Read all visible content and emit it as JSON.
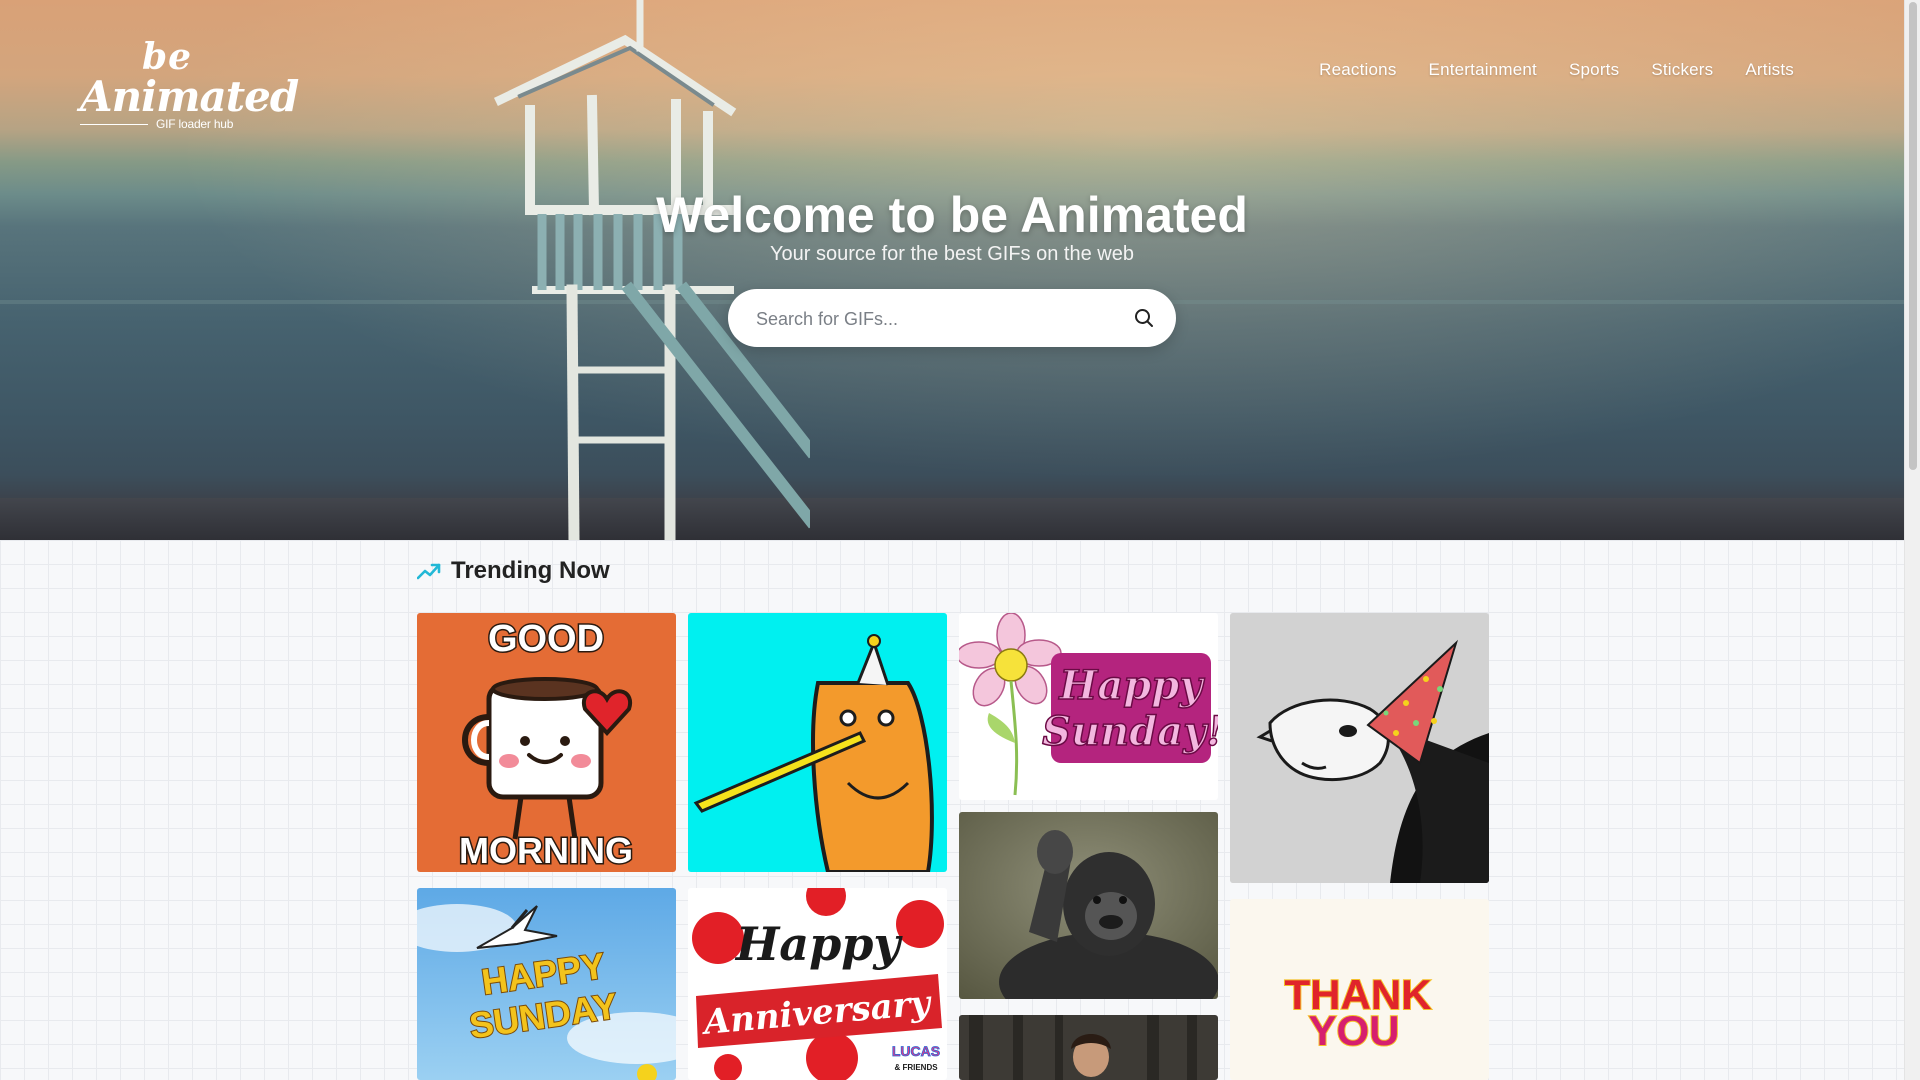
{
  "brand": {
    "logo_top": "be",
    "logo_main": "Animated",
    "tagline": "GIF loader hub"
  },
  "nav": {
    "items": [
      "Reactions",
      "Entertainment",
      "Sports",
      "Stickers",
      "Artists"
    ]
  },
  "hero": {
    "title": "Welcome to be Animated",
    "subtitle": "Your source for the best GIFs on the web"
  },
  "search": {
    "placeholder": "Search for GIFs...",
    "icon": "search-icon"
  },
  "trending": {
    "title": "Trending Now",
    "icon": "trending-up-icon",
    "accent": "#22b8d6",
    "gifs": [
      {
        "id": "good-morning",
        "text_top": "GOOD",
        "text_bottom": "MORNING"
      },
      {
        "id": "party-bear"
      },
      {
        "id": "happy-sunday-flower",
        "text_1": "Happy",
        "text_2": "Sunday!"
      },
      {
        "id": "party-girl"
      },
      {
        "id": "happy-sunday-bird",
        "text_1": "HAPPY",
        "text_2": "SUNDAY"
      },
      {
        "id": "happy-anniversary",
        "text_1": "Happy",
        "text_2": "Anniversary",
        "badge_1": "LUCAS",
        "badge_2": "& FRIENDS"
      },
      {
        "id": "clapping-gorilla"
      },
      {
        "id": "thank-you",
        "text_1": "THANK",
        "text_2": "YOU"
      },
      {
        "id": "child-forest"
      }
    ]
  },
  "colors": {
    "hero_sky": "#d9a177",
    "hero_sea": "#4a6773",
    "page_bg": "#f7f8fa",
    "heading": "#222222"
  }
}
